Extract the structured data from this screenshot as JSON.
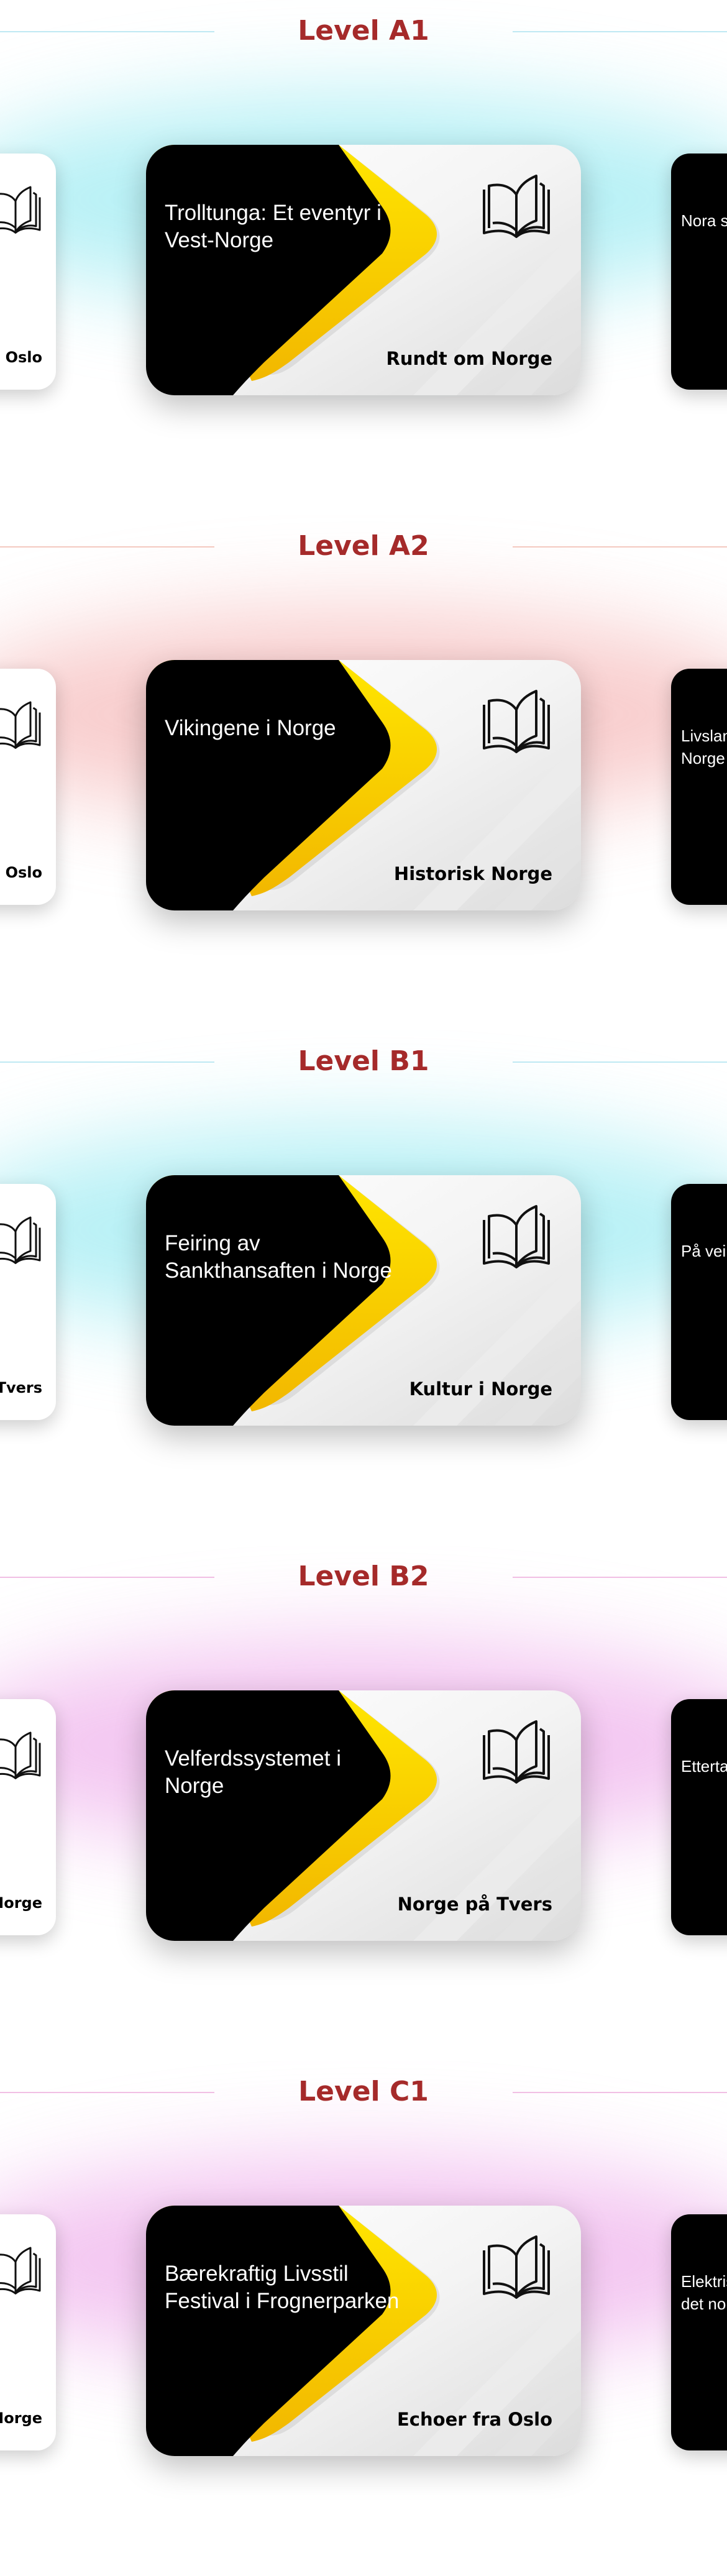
{
  "sections": [
    {
      "level": "Level A1",
      "line_color": "#bfe9f3",
      "glow_color": "#7fe5ee",
      "card": {
        "title": "Trolltunga: Et eventyr i Vest-Norge",
        "subtitle": "Rundt om Norge",
        "icon": "open-book-icon"
      },
      "left_peek": {
        "subtitle": "ra Oslo"
      },
      "right_peek": {
        "title": "Nora si"
      }
    },
    {
      "level": "Level A2",
      "line_color": "#f4c9c0",
      "glow_color": "#f3a6a6",
      "card": {
        "title": "Vikingene i Norge",
        "subtitle": "Historisk Norge",
        "icon": "open-book-icon"
      },
      "left_peek": {
        "subtitle": "ra Oslo"
      },
      "right_peek": {
        "title": "Livslan voksen Norge"
      }
    },
    {
      "level": "Level B1",
      "line_color": "#bfe9f3",
      "glow_color": "#7fe5ee",
      "card": {
        "title": "Feiring av Sankthansaften i Norge",
        "subtitle": "Kultur i Norge",
        "icon": "open-book-icon"
      },
      "left_peek": {
        "subtitle": "å Tvers"
      },
      "right_peek": {
        "title": "På vei ti Lofoten"
      }
    },
    {
      "level": "Level B2",
      "line_color": "#f1bfe4",
      "glow_color": "#ea9ae6",
      "card": {
        "title": "Velferdssystemet i Norge",
        "subtitle": "Norge på Tvers",
        "icon": "open-book-icon"
      },
      "left_peek": {
        "subtitle": "Norge"
      },
      "right_peek": {
        "title": "Ettertan Ekeberg"
      }
    },
    {
      "level": "Level C1",
      "line_color": "#f1bfe4",
      "glow_color": "#ea9ae6",
      "card": {
        "title": "Bærekraftig Livsstil Festival i Frognerparken",
        "subtitle": "Echoer fra Oslo",
        "icon": "open-book-icon"
      },
      "left_peek": {
        "subtitle": "Norge"
      },
      "right_peek": {
        "title": "Elektris kjøretøy det nor samfun"
      }
    }
  ],
  "colors": {
    "level_title": "#a52a2a",
    "accent_yellow": "#ffd400",
    "card_black": "#000000"
  }
}
